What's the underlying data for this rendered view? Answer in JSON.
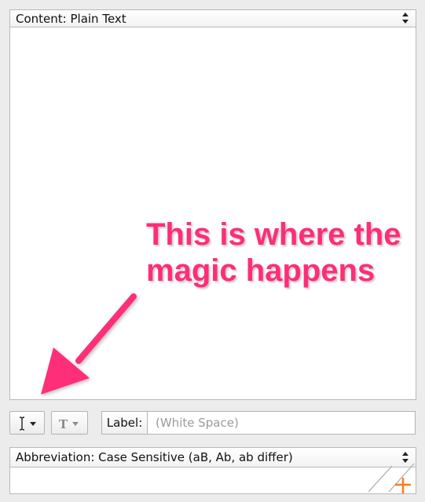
{
  "content_panel": {
    "popup_label": "Content: Plain Text",
    "editor_value": ""
  },
  "toolbar": {
    "cursor_button_icon": "text-cursor-icon",
    "font_button_icon": "font-icon",
    "label_caption": "Label:",
    "label_placeholder": "(White Space)",
    "label_value": ""
  },
  "abbreviation_panel": {
    "popup_label": "Abbreviation: Case Sensitive (aB, Ab, ab differ)",
    "value": ""
  },
  "annotation": {
    "line1": "This is where the",
    "line2": "magic happens",
    "color": "#ff2d78"
  },
  "colors": {
    "window_bg": "#ececec",
    "border": "#b9b9b9",
    "resize_plus": "#ff7a1a"
  }
}
